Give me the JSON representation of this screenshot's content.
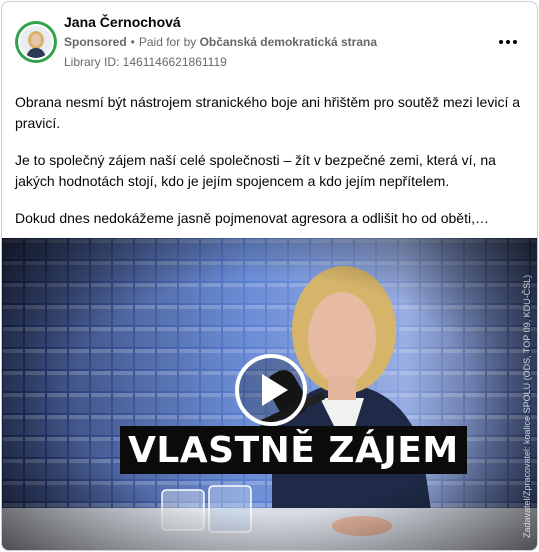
{
  "post": {
    "author_name": "Jana Černochová",
    "sponsored_label": "Sponsored",
    "paid_for_prefix": "Paid for by",
    "payer": "Občanská demokratická strana",
    "library_id": "Library ID: 1461146621861119",
    "more_icon": "more-horizontal-icon",
    "paragraphs": [
      "Obrana nesmí být nástrojem stranického boje ani hřištěm pro soutěž mezi levicí a pravicí.",
      "Je to společný zájem naší celé společnosti – žít v bezpečné zemi, která ví, na jakých hodnotách stojí, kdo je jejím spojencem a kdo jejím nepřítelem.",
      "Dokud dnes nedokážeme jasně pojmenovat agresora a odlišit ho od oběti,…"
    ]
  },
  "video": {
    "caption": "VLASTNĚ ZÁJEM",
    "vertical_disclaimer": "Zadavatel/Zpracovatel: koalice SPOLU (ODS, TOP 09, KDU-ČSL)",
    "play_icon": "play-icon"
  },
  "colors": {
    "avatar_ring": "#31a24c",
    "meta_text": "#65676b",
    "caption_bg": "#0b0b0b"
  }
}
